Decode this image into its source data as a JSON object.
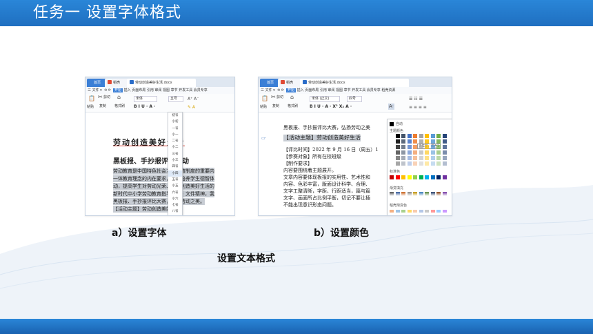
{
  "slide": {
    "title": "任务一   设置字体格式",
    "caption_a": "a）设置字体",
    "caption_b": "b）设置颜色",
    "caption_main": "设置文本格式",
    "colors": {
      "header": "#1f6fc0",
      "accent": "#3b7fd6"
    }
  },
  "shot_a": {
    "tabs": {
      "home": "首页",
      "daoke": "稻壳",
      "doc": "劳动创造美好生活.docx"
    },
    "menu": {
      "file": "三 文件 ▾",
      "start": "开始",
      "rest": "插入 页面布局 引用 审阅 视图 章节 开发工具 会员专享"
    },
    "toolbar": {
      "cut": "剪切",
      "paste": "粘贴",
      "copy": "复制",
      "format_painter": "格式刷",
      "font": "宋体",
      "size": "五号",
      "bius": "B  I  U · A ·"
    },
    "doc": {
      "heading": "劳动创造美好生活",
      "subheading": "黑板报、手抄报评比活动",
      "lines": [
        "劳动教育是中国特色社会主义教育制度的重要内",
        "一体教育理念的内在要求，为了培养学生德智体",
        "动，提高学生对劳动光荣、劳动创造美好生活的",
        "新时代中小学劳动教育指导纲要》文件精神，我",
        "黑板报、手抄报评比大赛，弘扬劳动之美。",
        "【活动主题】劳动创造美好生活"
      ]
    },
    "size_list": [
      "初号",
      "小初",
      "一号",
      "小一",
      "二号",
      "小二",
      "三号",
      "小三",
      "四号",
      "小四",
      "五号",
      "小五",
      "六号",
      "小六",
      "七号",
      "八号"
    ],
    "size_selected": "小四"
  },
  "shot_b": {
    "tabs": {
      "home": "首页",
      "daoke": "稻壳",
      "doc": "劳动创造美好生活.docx"
    },
    "menu": {
      "file": "三 文件 ▾",
      "start": "开始",
      "rest": "插入 页面布局 引用 审阅 视图 章节 开发工具 会员专享 稻壳资源"
    },
    "toolbar": {
      "cut": "剪切",
      "paste": "粘贴",
      "copy": "复制",
      "format_painter": "格式刷",
      "font": "宋体 (正文)",
      "size": "四号"
    },
    "doc": {
      "lines": [
        "黑板报、手抄报评比大赛，弘扬劳动之美",
        "【活动主题】劳动创造美好生活",
        "【评比时间】2022 年 9 月 16 日（周五）1",
        "【参赛对象】所有在校班级",
        "【制作要求】",
        "内容要围绕着主题展开。",
        "文章内容要体现板报的实用性、艺术性和",
        "内容、色彩丰富，版面设计科学、合理、",
        "文字工整清晰，字距、行距适当，篇与篇",
        "文字、画面所占比例平衡，切记不要让插",
        "不能出现意识形态问题。"
      ]
    },
    "color_panel": {
      "auto": "自动",
      "theme": "主题颜色",
      "standard": "标准色",
      "gradient_fill": "渐变填充",
      "gradient_color": "稻壳渐变色",
      "tooltip": "天车蓝，着色1"
    }
  }
}
